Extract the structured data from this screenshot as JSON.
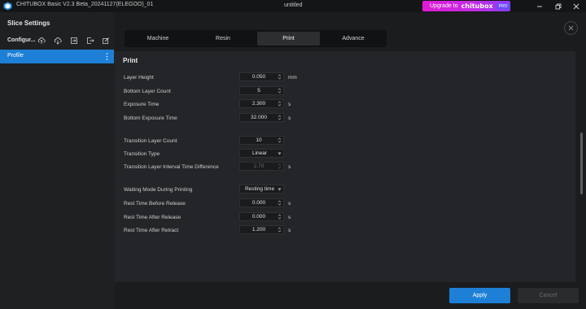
{
  "window": {
    "app_title": "CHITUBOX Basic V2.3 Beta_20241127(ELEGOO)_01",
    "document_title": "untitled",
    "upgrade": {
      "prefix": "Upgrade to",
      "brand": "chitubox",
      "badge": "PRO"
    }
  },
  "sidebar": {
    "title": "Slice Settings",
    "config_label": "Configur...",
    "profile_label": "Profile"
  },
  "tabs": [
    {
      "label": "Machine",
      "active": false
    },
    {
      "label": "Resin",
      "active": false
    },
    {
      "label": "Print",
      "active": true
    },
    {
      "label": "Advance",
      "active": false
    }
  ],
  "section": {
    "title": "Print"
  },
  "fields": {
    "layer_height": {
      "label": "Layer Height",
      "value": "0.050",
      "unit": "mm"
    },
    "bottom_layer_count": {
      "label": "Bottom Layer Count",
      "value": "5"
    },
    "exposure_time": {
      "label": "Exposure Time",
      "value": "2.300",
      "unit": "s"
    },
    "bottom_exposure_time": {
      "label": "Bottom Exposure Time",
      "value": "32.000",
      "unit": "s"
    },
    "transition_layer_count": {
      "label": "Transition Layer Count",
      "value": "10"
    },
    "transition_type": {
      "label": "Transition Type",
      "value": "Linear"
    },
    "transition_interval": {
      "label": "Transition Layer Interval Time Difference",
      "value": "2.70",
      "unit": "s"
    },
    "waiting_mode": {
      "label": "Waiting Mode During Printing",
      "value": "Resting time"
    },
    "rest_before_release": {
      "label": "Rest Time Before Release",
      "value": "0.000",
      "unit": "s"
    },
    "rest_after_release": {
      "label": "Rest Time After Release",
      "value": "0.000",
      "unit": "s"
    },
    "rest_after_retract": {
      "label": "Rest Time After Retract",
      "value": "1.200",
      "unit": "s"
    }
  },
  "footer": {
    "apply_label": "Apply",
    "cancel_label": "Cancel"
  },
  "colors": {
    "accent": "#1e7fd6",
    "upgrade_gradient_start": "#e01bd3",
    "background": "#1b1c1e"
  }
}
